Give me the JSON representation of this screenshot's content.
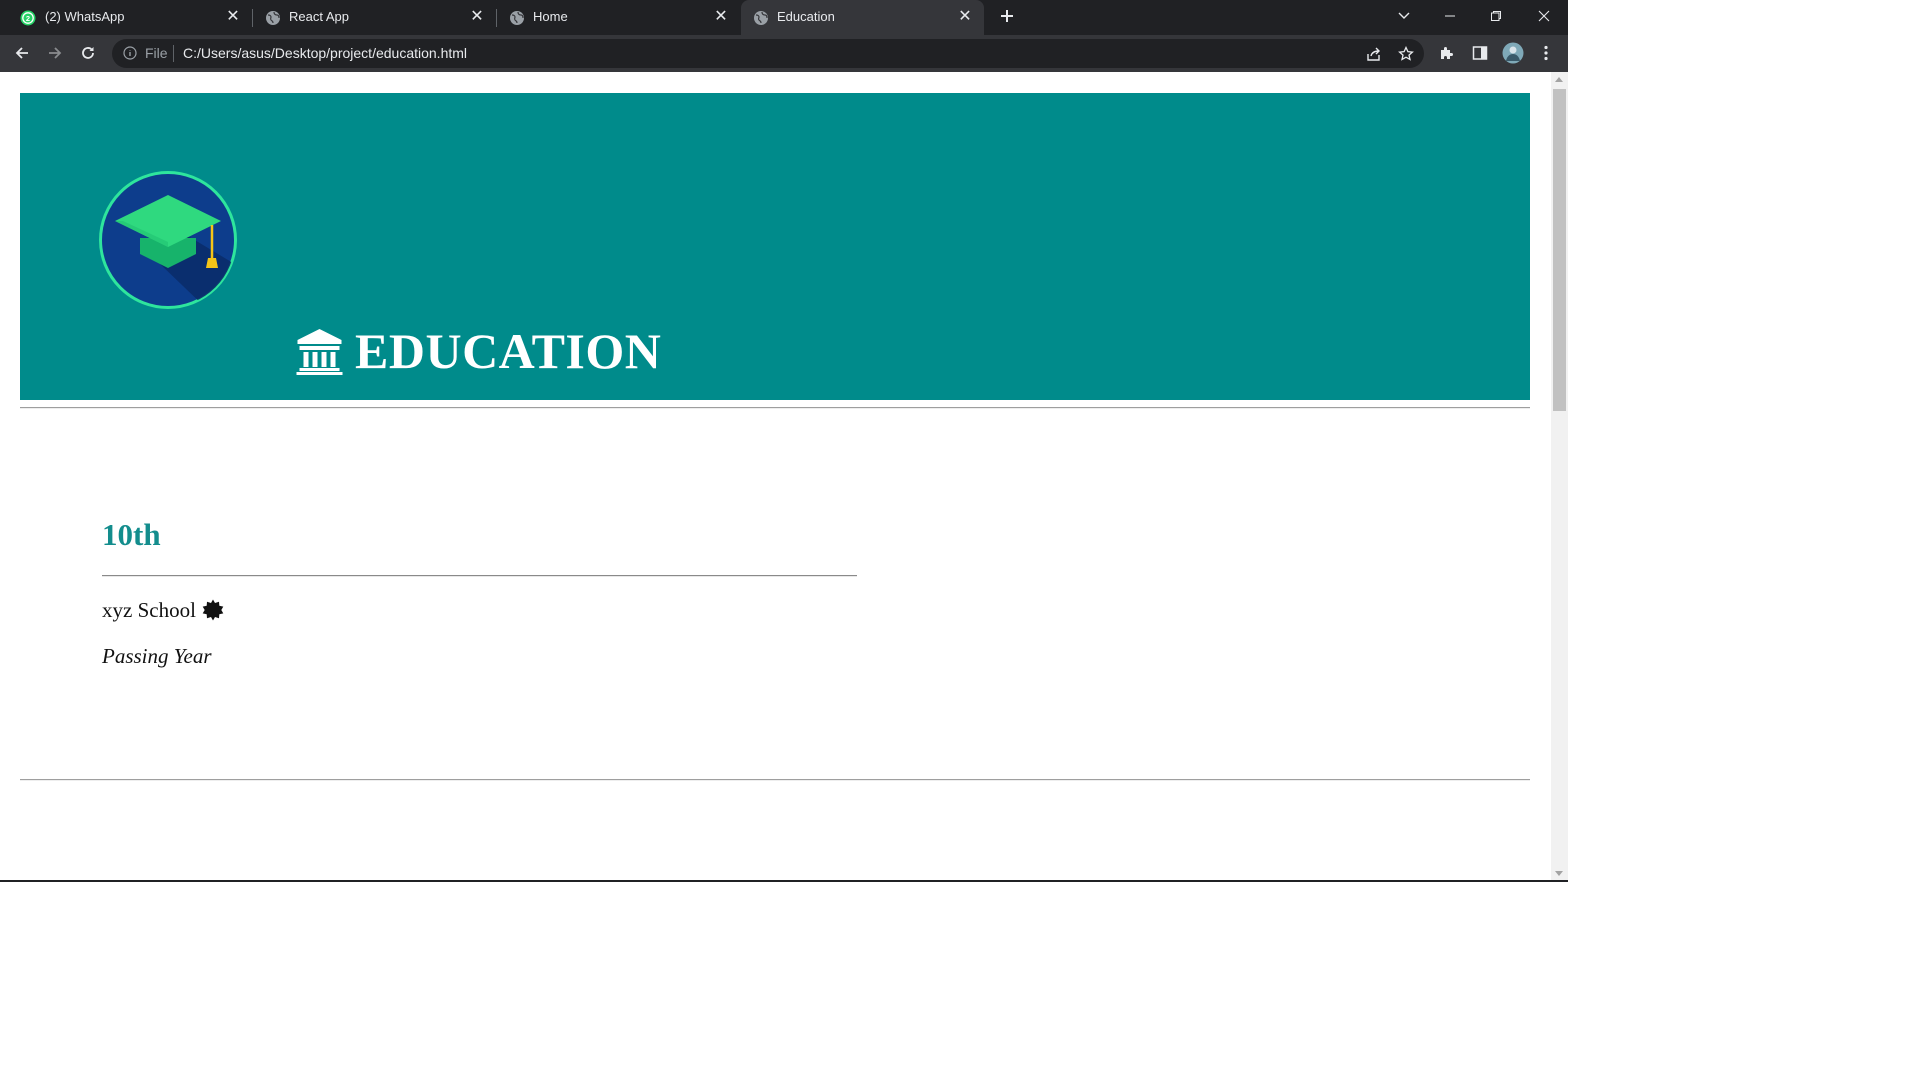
{
  "browser": {
    "tabs": [
      {
        "title": "(2) WhatsApp",
        "favicon": "whatsapp-icon",
        "badge": "2",
        "active": false
      },
      {
        "title": "React App",
        "favicon": "globe-icon",
        "active": false
      },
      {
        "title": "Home",
        "favicon": "globe-icon",
        "active": false
      },
      {
        "title": "Education",
        "favicon": "globe-icon",
        "active": true
      }
    ],
    "address_scheme": "File",
    "address_url": "C:/Users/asus/Desktop/project/education.html"
  },
  "colors": {
    "banner": "#008b8b",
    "heading": "#138d8d",
    "logo_ring": "#2ee59d",
    "logo_bg": "#0d3d8c",
    "cap": "#1fd37a",
    "tassel": "#f5c518"
  },
  "page": {
    "banner": {
      "title": "EDUCATION",
      "logo_icon": "graduation-cap-icon",
      "title_icon": "institution-icon"
    },
    "education": {
      "level": "10th",
      "school": "xyz School",
      "school_icon": "badge-icon",
      "passing_label": "Passing Year"
    }
  }
}
